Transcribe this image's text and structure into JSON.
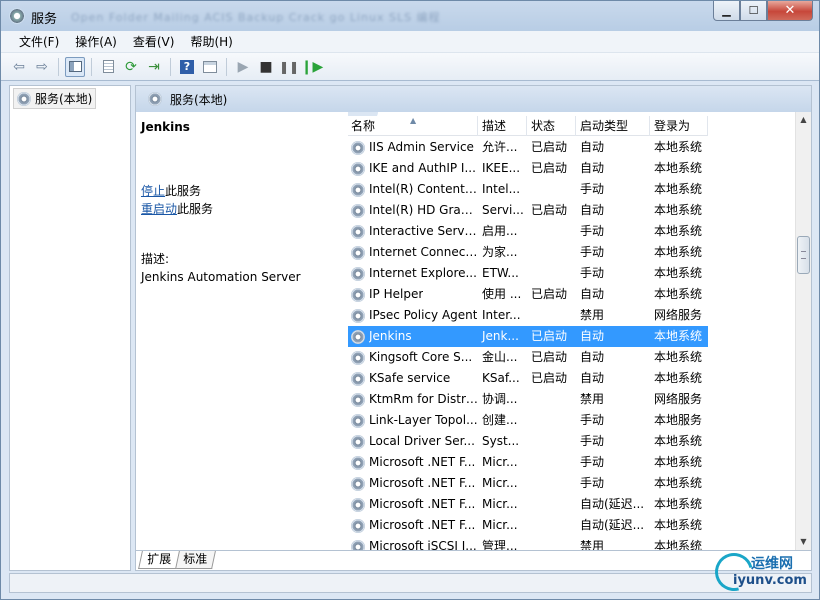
{
  "window": {
    "title": "服务",
    "blurred_taskbar": "Open Folder    Mailing    ACIS    Backup    Crack    go    Linux    SLS    编程"
  },
  "menu": [
    "文件(F)",
    "操作(A)",
    "查看(V)",
    "帮助(H)"
  ],
  "toolbar": [
    "back-icon",
    "forward-icon",
    "show-tree-icon",
    "properties-icon",
    "refresh-icon",
    "export-icon",
    "help-icon",
    "view-icon",
    "play-icon",
    "stop-icon",
    "pause-icon",
    "resume-icon"
  ],
  "tree": {
    "root_label": "服务(本地)"
  },
  "pane_header": "服务(本地)",
  "detail": {
    "service_name": "Jenkins",
    "stop_link": "停止",
    "stop_suffix": "此服务",
    "restart_link": "重启动",
    "restart_suffix": "此服务",
    "desc_label": "描述:",
    "desc_text": "Jenkins Automation Server"
  },
  "columns": {
    "name": "名称",
    "desc": "描述",
    "status": "状态",
    "startup": "启动类型",
    "logon": "登录为"
  },
  "services": [
    {
      "name": "IIS Admin Service",
      "desc": "允许...",
      "status": "已启动",
      "startup": "自动",
      "logon": "本地系统"
    },
    {
      "name": "IKE and AuthIP I...",
      "desc": "IKEE...",
      "status": "已启动",
      "startup": "自动",
      "logon": "本地系统"
    },
    {
      "name": "Intel(R) Content ...",
      "desc": "Intel...",
      "status": "",
      "startup": "手动",
      "logon": "本地系统"
    },
    {
      "name": "Intel(R) HD Grap...",
      "desc": "Servi...",
      "status": "已启动",
      "startup": "自动",
      "logon": "本地系统"
    },
    {
      "name": "Interactive Servi...",
      "desc": "启用...",
      "status": "",
      "startup": "手动",
      "logon": "本地系统"
    },
    {
      "name": "Internet Connect...",
      "desc": "为家...",
      "status": "",
      "startup": "手动",
      "logon": "本地系统"
    },
    {
      "name": "Internet Explore...",
      "desc": "ETW...",
      "status": "",
      "startup": "手动",
      "logon": "本地系统"
    },
    {
      "name": "IP Helper",
      "desc": "使用 ...",
      "status": "已启动",
      "startup": "自动",
      "logon": "本地系统"
    },
    {
      "name": "IPsec Policy Agent",
      "desc": "Inter...",
      "status": "",
      "startup": "禁用",
      "logon": "网络服务"
    },
    {
      "name": "Jenkins",
      "desc": "Jenk...",
      "status": "已启动",
      "startup": "自动",
      "logon": "本地系统",
      "selected": true
    },
    {
      "name": "Kingsoft Core S...",
      "desc": "金山...",
      "status": "已启动",
      "startup": "自动",
      "logon": "本地系统"
    },
    {
      "name": "KSafe service",
      "desc": "KSaf...",
      "status": "已启动",
      "startup": "自动",
      "logon": "本地系统"
    },
    {
      "name": "KtmRm for Distri...",
      "desc": "协调...",
      "status": "",
      "startup": "禁用",
      "logon": "网络服务"
    },
    {
      "name": "Link-Layer Topol...",
      "desc": "创建...",
      "status": "",
      "startup": "手动",
      "logon": "本地服务"
    },
    {
      "name": "Local Driver Ser...",
      "desc": "Syst...",
      "status": "",
      "startup": "手动",
      "logon": "本地系统"
    },
    {
      "name": "Microsoft .NET F...",
      "desc": "Micr...",
      "status": "",
      "startup": "手动",
      "logon": "本地系统"
    },
    {
      "name": "Microsoft .NET F...",
      "desc": "Micr...",
      "status": "",
      "startup": "手动",
      "logon": "本地系统"
    },
    {
      "name": "Microsoft .NET F...",
      "desc": "Micr...",
      "status": "",
      "startup": "自动(延迟...",
      "logon": "本地系统"
    },
    {
      "name": "Microsoft .NET F...",
      "desc": "Micr...",
      "status": "",
      "startup": "自动(延迟...",
      "logon": "本地系统"
    },
    {
      "name": "Microsoft iSCSI I...",
      "desc": "管理...",
      "status": "",
      "startup": "禁用",
      "logon": "本地系统"
    }
  ],
  "tabs": [
    "扩展",
    "标准"
  ],
  "watermark": {
    "top": "运维网",
    "bottom": "iyunv.com"
  }
}
